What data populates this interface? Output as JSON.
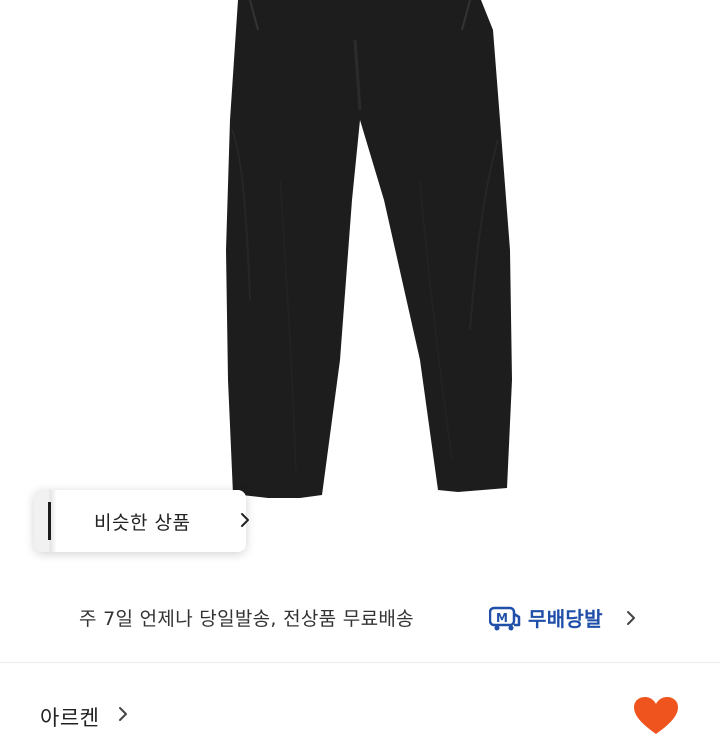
{
  "product_image": {
    "alt": "black trousers",
    "colors": {
      "garment": "#1d1d1d",
      "background": "#ffffff"
    }
  },
  "similar_products": {
    "label": "비슷한 상품",
    "icon": "chevron-right-icon"
  },
  "shipping": {
    "text": "주 7일 언제나 당일발송, 전상품 무료배송",
    "badge_icon": "truck-m-icon",
    "brand": "무배당발",
    "brand_color": "#1f4fa8",
    "chevron": "chevron-right-icon"
  },
  "seller": {
    "name": "아르켄",
    "chevron": "chevron-right-icon"
  },
  "like": {
    "icon": "heart-icon",
    "color": "#f0541e"
  }
}
